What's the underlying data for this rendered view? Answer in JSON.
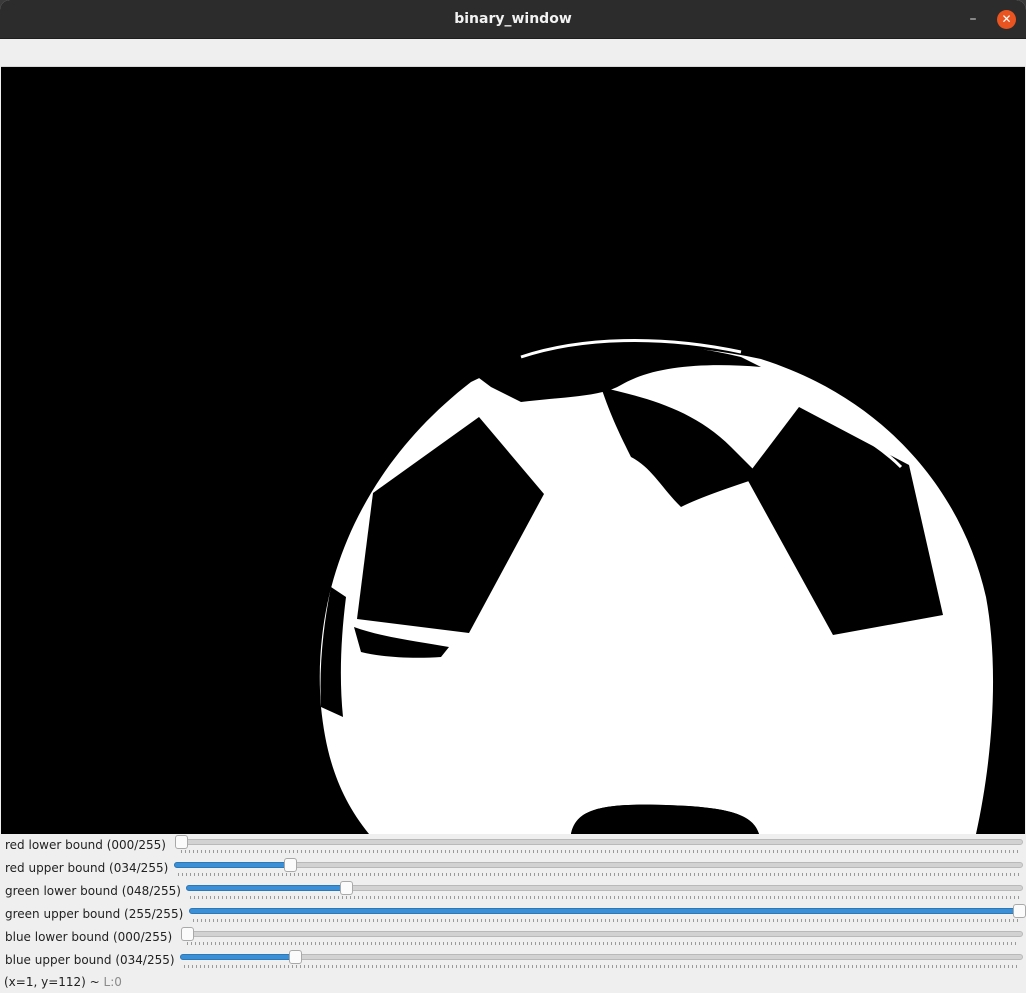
{
  "window": {
    "title": "binary_window",
    "minimize_symbol": "–",
    "close_symbol": "✕",
    "close_color": "#e95420"
  },
  "image": {
    "description_icon": "binary-mask-image",
    "background_color": "#000000",
    "foreground_color": "#ffffff"
  },
  "trackbars": [
    {
      "label": "red lower bound (000/255)",
      "value": 0,
      "max": 255
    },
    {
      "label": "red upper bound (034/255)",
      "value": 34,
      "max": 255
    },
    {
      "label": "green lower bound (048/255)",
      "value": 48,
      "max": 255
    },
    {
      "label": "green upper bound (255/255)",
      "value": 255,
      "max": 255
    },
    {
      "label": "blue lower bound (000/255)",
      "value": 0,
      "max": 255
    },
    {
      "label": "blue upper bound (034/255)",
      "value": 34,
      "max": 255
    }
  ],
  "status": {
    "coords": "(x=1, y=112) ~",
    "level": "L:0"
  },
  "colors": {
    "slider_fill": "#3a8fd6",
    "titlebar": "#2c2c2c"
  }
}
